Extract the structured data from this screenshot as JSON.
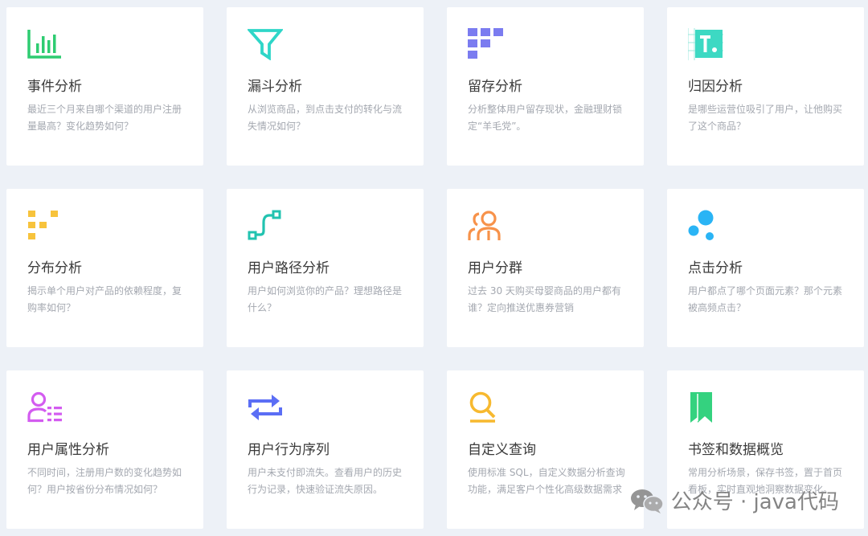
{
  "cards": [
    {
      "title": "事件分析",
      "desc": "最近三个月来自哪个渠道的用户注册量最高？变化趋势如何？",
      "icon": "bar-chart-icon",
      "color": "#2ecc71"
    },
    {
      "title": "漏斗分析",
      "desc": "从浏览商品，到点击支付的转化与流失情况如何？",
      "icon": "funnel-icon",
      "color": "#2ed6c8"
    },
    {
      "title": "留存分析",
      "desc": "分析整体用户留存现状，金融理财锁定“羊毛党”。",
      "icon": "grid-blocks-icon",
      "color": "#7b7cf0"
    },
    {
      "title": "归因分析",
      "desc": "是哪些运营位吸引了用户，让他购买了这个商品？",
      "icon": "text-table-icon",
      "color": "#3dd9c3"
    },
    {
      "title": "分布分析",
      "desc": "揭示单个用户对产品的依赖程度，复购率如何？",
      "icon": "distribution-icon",
      "color": "#f7c33c"
    },
    {
      "title": "用户路径分析",
      "desc": "用户如何浏览你的产品？理想路径是什么？",
      "icon": "path-icon",
      "color": "#22c3b0"
    },
    {
      "title": "用户分群",
      "desc": "过去 30 天购买母婴商品的用户都有谁？定向推送优惠券营销",
      "icon": "user-group-icon",
      "color": "#f7924a"
    },
    {
      "title": "点击分析",
      "desc": "用户都点了哪个页面元素？那个元素被高频点击？",
      "icon": "click-dots-icon",
      "color": "#2ab4f5"
    },
    {
      "title": "用户属性分析",
      "desc": "不同时间，注册用户数的变化趋势如何？用户按省份分布情况如何？",
      "icon": "user-attribute-icon",
      "color": "#d35cf0"
    },
    {
      "title": "用户行为序列",
      "desc": "用户未支付即流失。查看用户的历史行为记录，快速验证流失原因。",
      "icon": "swap-arrows-icon",
      "color": "#5b6ef5"
    },
    {
      "title": "自定义查询",
      "desc": "使用标准 SQL，自定义数据分析查询功能，满足客户个性化高级数据需求",
      "icon": "search-icon",
      "color": "#f7b92f"
    },
    {
      "title": "书签和数据概览",
      "desc": "常用分析场景，保存书签，置于首页看板，实时直观地洞察数据变化。",
      "icon": "bookmark-icon",
      "color": "#34d27f"
    }
  ],
  "watermark": {
    "text": "公众号 · java代码",
    "icon": "wechat-icon"
  }
}
